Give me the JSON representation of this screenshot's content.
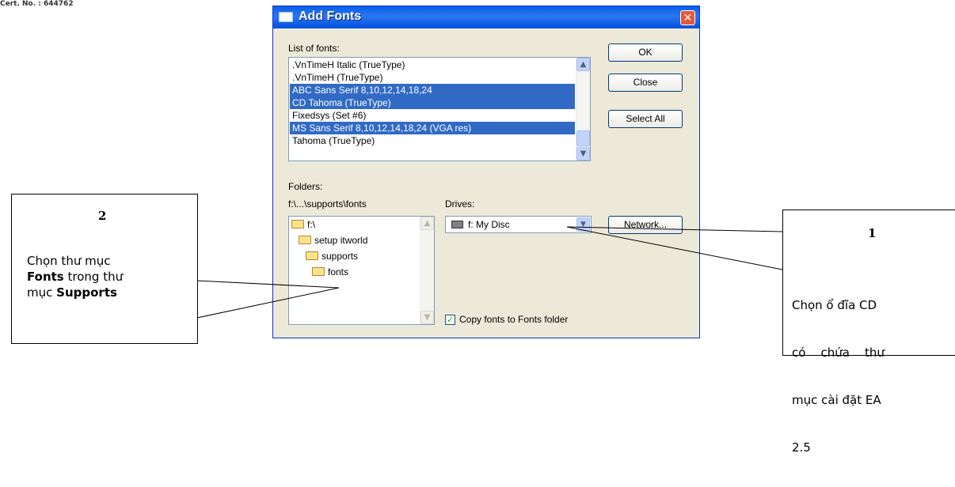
{
  "cert": "Cert. No. : 644762",
  "dialog": {
    "title": "Add Fonts",
    "list_label": "List of fonts:",
    "fonts": [
      {
        "name": ".VnTimeH  Italic (TrueType)",
        "selected": false
      },
      {
        "name": ".VnTimeH (TrueType)",
        "selected": false
      },
      {
        "name": "ABC Sans Serif 8,10,12,14,18,24",
        "selected": true
      },
      {
        "name": "CD Tahoma (TrueType)",
        "selected": true
      },
      {
        "name": "Fixedsys (Set #6)",
        "selected": false
      },
      {
        "name": "MS Sans Serif 8,10,12,14,18,24 (VGA res)",
        "selected": true
      },
      {
        "name": "Tahoma (TrueType)",
        "selected": false
      }
    ],
    "buttons": {
      "ok": "OK",
      "close": "Close",
      "select_all": "Select All",
      "network": "Network..."
    },
    "folders_label": "Folders:",
    "folder_path": "f:\\...\\supports\\fonts",
    "folders": [
      {
        "name": "f:\\",
        "icon": "open-folder-icon"
      },
      {
        "name": "setup itworld",
        "icon": "open-folder-icon"
      },
      {
        "name": "supports",
        "icon": "open-folder-icon"
      },
      {
        "name": "fonts",
        "icon": "open-folder-icon"
      }
    ],
    "drives_label": "Drives:",
    "drive": "f: My Disc",
    "copy_label": "Copy fonts to Fonts folder",
    "copy_checked": true
  },
  "callout_left": {
    "number": "2",
    "text_a": "Chọn thư mục",
    "bold_a": "Fonts",
    "text_b": "trong thư",
    "text_c": "mục",
    "bold_b": "Supports"
  },
  "callout_right": {
    "number": "1",
    "line1": "Chọn ổ đĩa CD",
    "line2": "có    chứa    thư",
    "line3": "mục cài đặt EA",
    "line4": "2.5"
  }
}
